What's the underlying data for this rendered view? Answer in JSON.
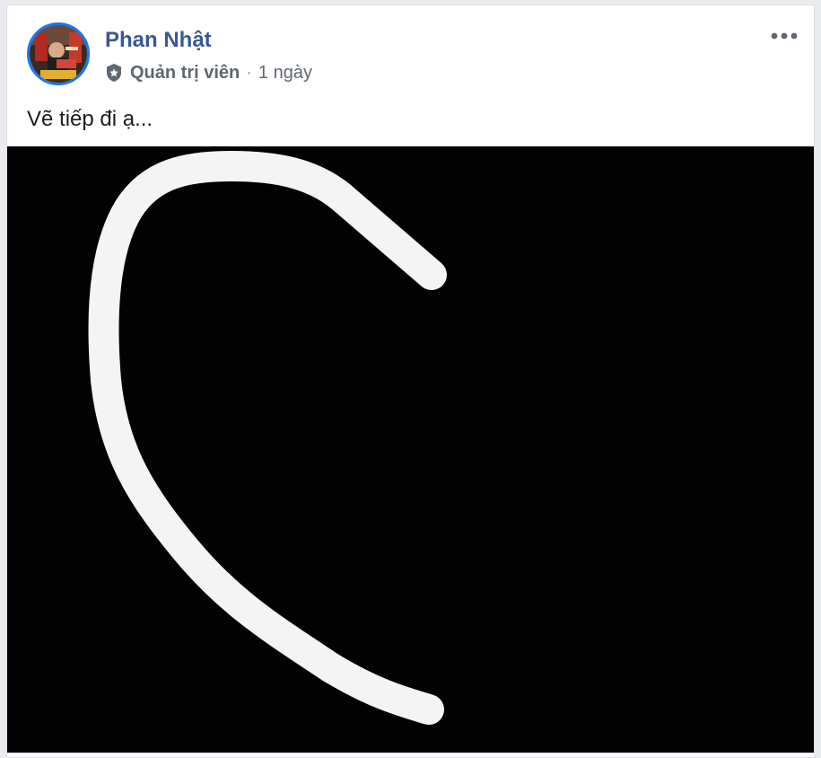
{
  "post": {
    "author": "Phan Nhật",
    "role": "Quản trị viên",
    "separator": "·",
    "time": "1 ngày",
    "text": "Vẽ tiếp đi ạ...",
    "photo_description": "White curved line drawn on black background (half of a heart)"
  },
  "icons": {
    "role_badge": "shield-icon",
    "more": "more-options-icon"
  },
  "colors": {
    "author_name": "#385898",
    "avatar_ring": "#1877f2",
    "meta_text": "#606770",
    "post_text": "#1c1e21",
    "photo_background": "#020202",
    "stroke": "#f4f4f4"
  }
}
